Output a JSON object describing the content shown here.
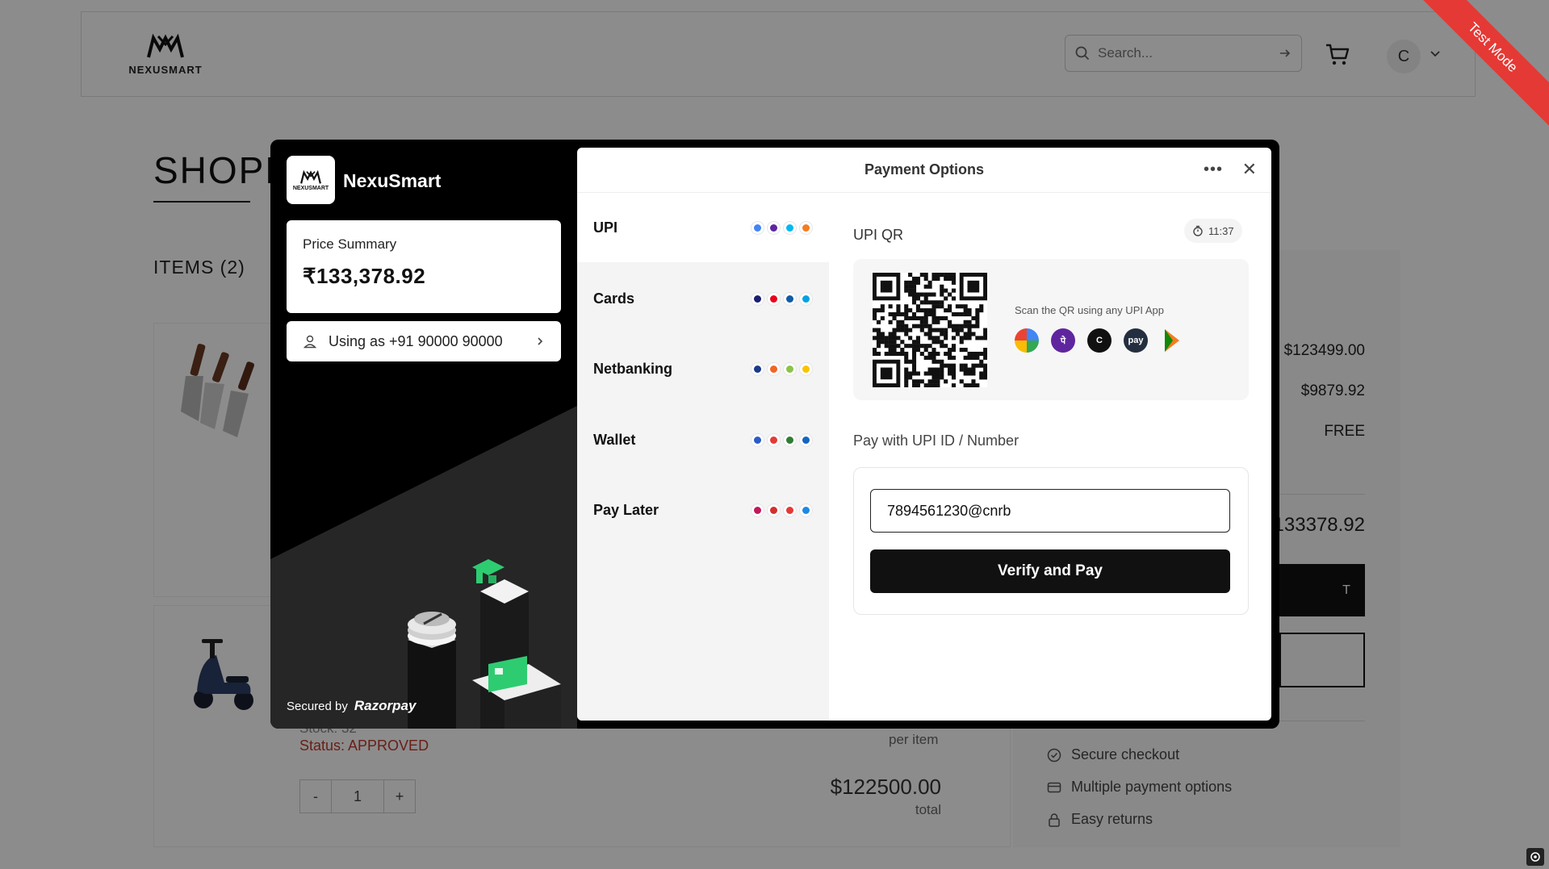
{
  "header": {
    "logo_text": "NEXUSMART",
    "search_placeholder": "Search...",
    "avatar_initial": "C"
  },
  "page": {
    "title": "SHOPP",
    "items_label": "ITEMS (2)"
  },
  "items": [
    {
      "stock": "Stock: 32",
      "status": "Status: APPROVED",
      "per_item": "per item",
      "quantity": "1",
      "qty_minus": "-",
      "qty_plus": "+",
      "line_total": "$122500.00",
      "line_total_label": "total"
    }
  ],
  "summary": {
    "subtotal": "$123499.00",
    "tax": "$9879.92",
    "shipping": "FREE",
    "total": "$133378.92",
    "checkout_label": "T",
    "features": [
      "Secure checkout",
      "Multiple payment options",
      "Easy returns"
    ]
  },
  "ribbon": {
    "text": "Test Mode"
  },
  "modal": {
    "brand_name": "NexuSmart",
    "brand_logo_text": "NEXUSMART",
    "price_label": "Price Summary",
    "price_value": "₹133,378.92",
    "user_text": "Using as +91 90000 90000",
    "secured_by": "Secured by",
    "razorpay": "Razorpay",
    "title": "Payment Options",
    "more": "•••",
    "close": "✕",
    "methods": [
      {
        "name": "UPI"
      },
      {
        "name": "Cards"
      },
      {
        "name": "Netbanking"
      },
      {
        "name": "Wallet"
      },
      {
        "name": "Pay Later"
      }
    ],
    "qr_title": "UPI QR",
    "timer": "11:37",
    "scan_text": "Scan the QR using any UPI App",
    "upi_id_title": "Pay with UPI ID / Number",
    "upi_value": "7894561230@cnrb",
    "verify_label": "Verify and Pay"
  },
  "colors": {
    "ribbon": "#e53935",
    "status_red": "#c0392b",
    "phonepe": "#5f259f",
    "cred": "#111111",
    "amazon": "#232f3e"
  }
}
